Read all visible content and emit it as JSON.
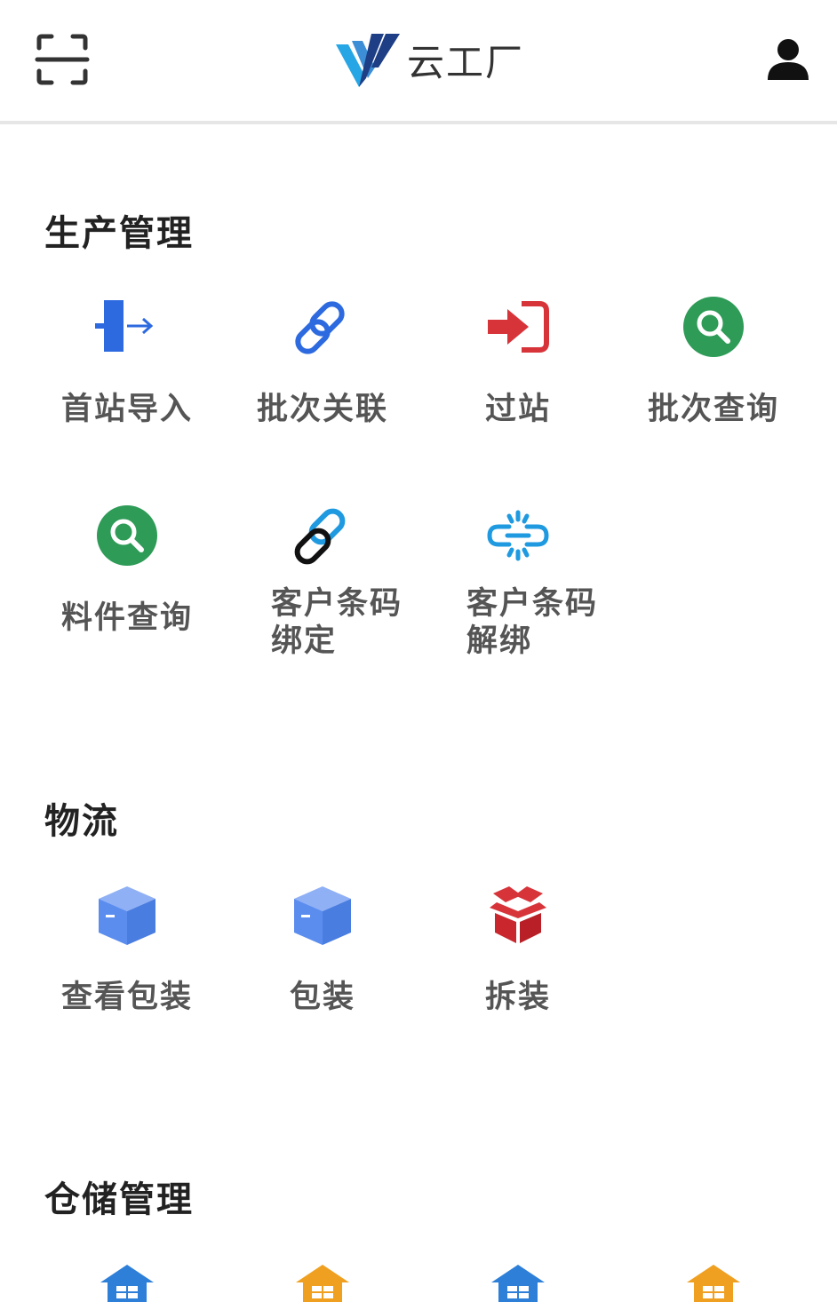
{
  "header": {
    "logo_text": "云工厂",
    "scan_icon": "scan-icon",
    "user_icon": "user-icon"
  },
  "sections": [
    {
      "title": "生产管理",
      "items": [
        {
          "label": "首站导入",
          "icon": "import-icon",
          "color": "#2d6ae0"
        },
        {
          "label": "批次关联",
          "icon": "link-icon",
          "color": "#2d6ae0"
        },
        {
          "label": "过站",
          "icon": "sign-in-icon",
          "color": "#d7343a"
        },
        {
          "label": "批次查询",
          "icon": "search-circle-icon",
          "color": "#2e9b57"
        },
        {
          "label": "料件查询",
          "icon": "search-circle-icon",
          "color": "#2e9b57"
        },
        {
          "label": "客户条码绑定",
          "line1": "客户条码",
          "line2": "绑定",
          "icon": "link-bind-icon",
          "color": "#1f9ae0"
        },
        {
          "label": "客户条码解绑",
          "line1": "客户条码",
          "line2": "解绑",
          "icon": "unlink-icon",
          "color": "#1f9ae0"
        }
      ]
    },
    {
      "title": "物流",
      "items": [
        {
          "label": "查看包装",
          "icon": "box-icon",
          "color": "#5b8def"
        },
        {
          "label": "包装",
          "icon": "box-icon",
          "color": "#5b8def"
        },
        {
          "label": "拆装",
          "icon": "open-box-icon",
          "color": "#d7343a"
        }
      ]
    },
    {
      "title": "仓储管理",
      "items": [
        {
          "icon": "warehouse-icon",
          "color": "#2d7fd8"
        },
        {
          "icon": "warehouse-icon",
          "color": "#f0a020"
        },
        {
          "icon": "warehouse-icon",
          "color": "#2d7fd8"
        },
        {
          "icon": "warehouse-icon",
          "color": "#f0a020"
        }
      ]
    }
  ]
}
